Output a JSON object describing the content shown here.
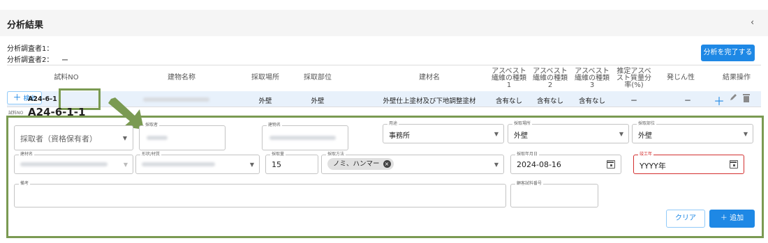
{
  "header": {
    "title": "分析結果",
    "collapse_icon": "chevron-left-icon"
  },
  "investigators": {
    "label1": "分析調査者1：",
    "label2": "分析調査者2：",
    "value2": "ー"
  },
  "complete_button": "分析を完了する",
  "table": {
    "headers": [
      "試料NO",
      "建物名称",
      "採取場所",
      "採取部位",
      "建材名",
      "アスベスト 繊維の種類 1",
      "アスベスト 繊維の種類 2",
      "アスベスト 繊維の種類 3",
      "推定アスベ スト質量分 率(%)",
      "発じん性",
      "結果操作"
    ],
    "row": {
      "sample_no": "A24-6-1",
      "kenshutsu_label": "検出",
      "place": "外壁",
      "part": "外壁",
      "material": "外壁仕上塗材及び下地調整塗材",
      "type1": "含有なし",
      "type2": "含有なし",
      "type3": "含有なし",
      "ratio": "ー",
      "dust": "ー"
    }
  },
  "sample_heading": {
    "label": "試料NO",
    "value": "A24-6-1-1"
  },
  "form": {
    "collector": {
      "placeholder": "採取者（資格保有者）"
    },
    "collector_name": {
      "label": "採取者"
    },
    "building_name": {
      "label": "建物名"
    },
    "usage": {
      "label": "用途",
      "value": "事務所"
    },
    "place": {
      "label": "採取場所",
      "value": "外壁"
    },
    "part": {
      "label": "採取部位",
      "value": "外壁"
    },
    "material_name": {
      "label": "建材名"
    },
    "shape": {
      "label": "形状/材質"
    },
    "amount": {
      "label": "採取量",
      "value": "15"
    },
    "method": {
      "label": "採取方法",
      "chip": "ノミ、ハンマー"
    },
    "date": {
      "label": "採取年月日",
      "value": "2024-08-16"
    },
    "year": {
      "label": "竣工年",
      "placeholder": "YYYY年"
    },
    "note": {
      "label": "備考"
    },
    "customer_no": {
      "label": "顧客試料番号"
    },
    "clear_button": "クリア",
    "add_button": "＋ 追加"
  },
  "colors": {
    "accent": "#1e88e5",
    "highlight": "#7a9a52",
    "error": "#d32f2f",
    "row_selected": "#e8f1fb"
  }
}
